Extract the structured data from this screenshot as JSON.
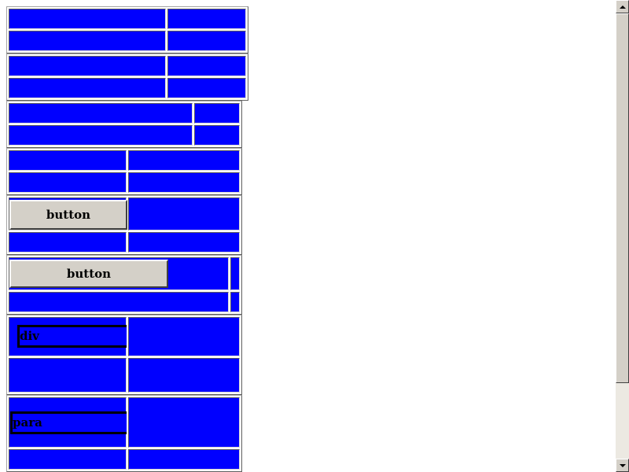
{
  "buttons": {
    "button_1": "button",
    "button_2": "button"
  },
  "boxes": {
    "div_label": "div",
    "para_label": "para"
  },
  "icons": {
    "scroll_up": "arrow-up-icon",
    "scroll_down": "arrow-down-icon"
  },
  "colors": {
    "cell_fill": "#0000ff",
    "button_face": "#d4d0c8",
    "background": "#ffffff"
  }
}
